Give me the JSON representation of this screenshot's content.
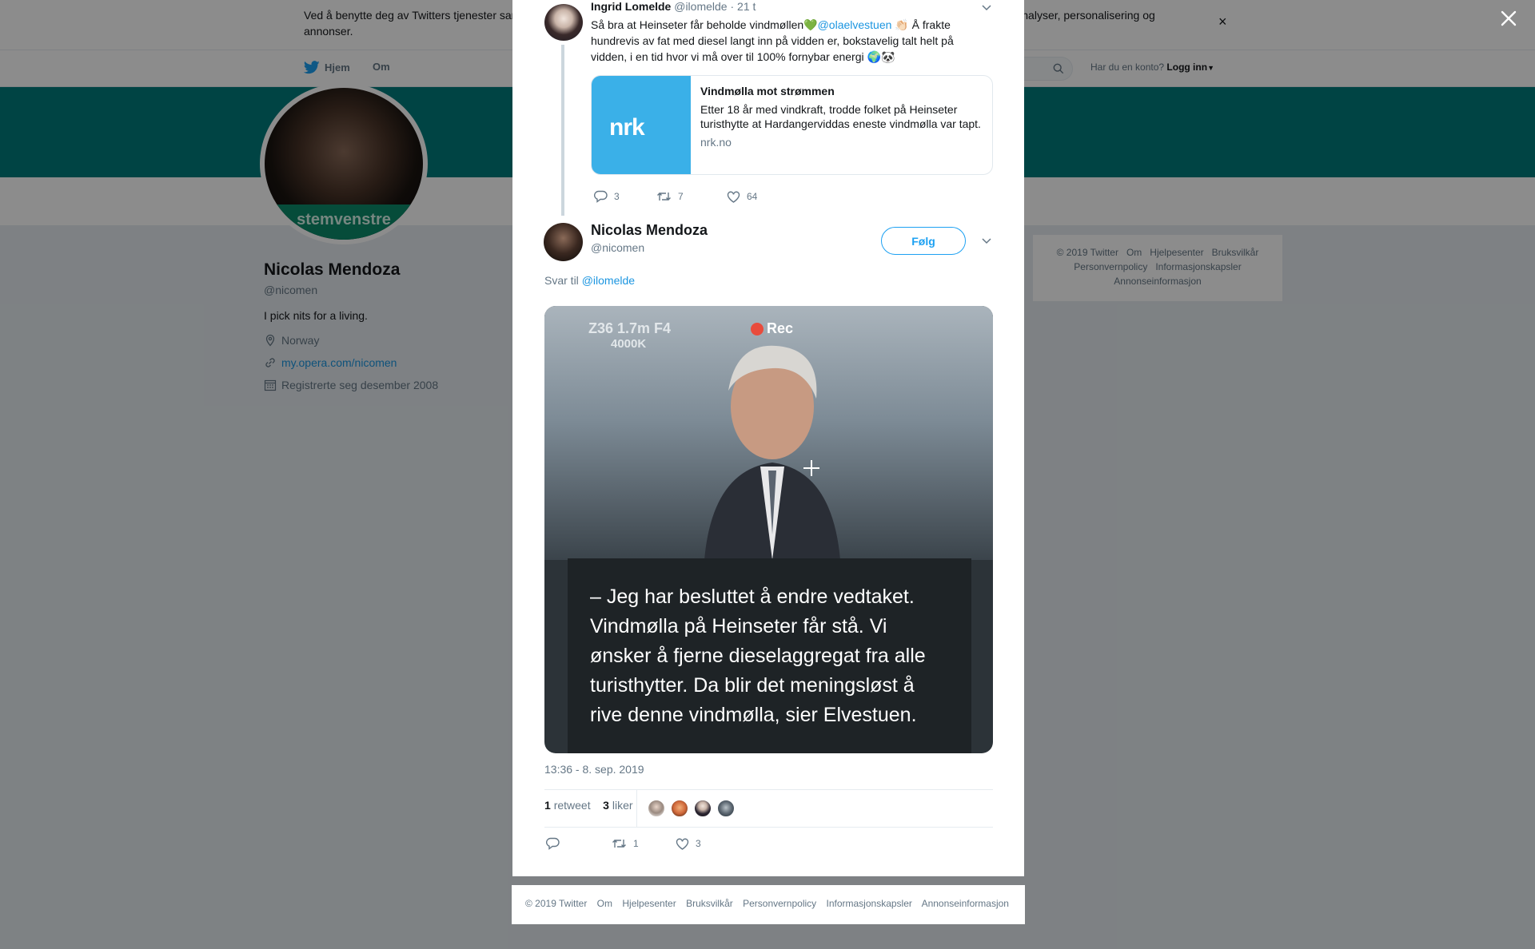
{
  "cookie_banner": {
    "text": "Ved å benytte deg av Twitters tjenester samtykker du i vår bruk av informasjonskapsler. Vi og partnerne våre bruker informasjonskapsler til bl.a. analyser, personalisering og annonser.",
    "close": "×"
  },
  "nav": {
    "home": "Hjem",
    "about": "Om",
    "login_prompt": "Har du en konto?",
    "login": "Logg inn"
  },
  "profile": {
    "avatar_text": "stemvenstre",
    "name": "Nicolas Mendoza",
    "handle": "@nicomen",
    "bio": "I pick nits for a living.",
    "location": "Norway",
    "url": "my.opera.com/nicomen",
    "joined": "Registrerte seg desember 2008"
  },
  "side_footer": {
    "links": [
      "© 2019 Twitter",
      "Om",
      "Hjelpesenter",
      "Bruksvilkår",
      "Personvernpolicy",
      "Informasjonskapsler",
      "Annonseinformasjon"
    ]
  },
  "parent_tweet": {
    "name": "Ingrid Lomelde",
    "handle": "@ilomelde",
    "time": "· 21 t",
    "text_before": "Så bra at Heinseter får beholde vindmøllen",
    "emoji_heart": "💚",
    "mention": "@olaelvestuen",
    "emoji_clap": "👏🏻",
    "text_after": " Å frakte hundrevis av fat med diesel langt inn på vidden er, bokstavelig talt helt på vidden, i en tid hvor vi må over til 100% fornybar energi ",
    "emoji_end": "🌍🐼",
    "card": {
      "logo": "nrk",
      "title": "Vindmølla mot strømmen",
      "description": "Etter 18 år med vindkraft, trodde folket på Heinseter turisthytte at Hardangerviddas eneste vindmølla var tapt.",
      "domain": "nrk.no"
    },
    "replies": "3",
    "retweets": "7",
    "likes": "64"
  },
  "main_tweet": {
    "name": "Nicolas Mendoza",
    "handle": "@nicomen",
    "follow_label": "Følg",
    "reply_prefix": "Svar til",
    "reply_mention": "@ilomelde",
    "media": {
      "hud": "Z36  1.7m  F4",
      "hud2": "4000K",
      "rec": "Rec",
      "quote": "– Jeg har besluttet å endre vedtaket. Vindmølla på Heinseter får stå. Vi ønsker å fjerne dieselaggregat fra alle turisthytter. Da blir det meningsløst å rive denne vindmølla, sier Elvestuen."
    },
    "timestamp": "13:36 - 8. sep. 2019",
    "retweet_count": "1",
    "retweet_label": "retweet",
    "like_count": "3",
    "like_label": "liker",
    "action_retweets": "1",
    "action_likes": "3"
  },
  "modal_footer": {
    "links": [
      "© 2019 Twitter",
      "Om",
      "Hjelpesenter",
      "Bruksvilkår",
      "Personvernpolicy",
      "Informasjonskapsler",
      "Annonseinformasjon"
    ]
  },
  "colors": {
    "brand_blue": "#1da1f2",
    "link_blue": "#1b95e0",
    "banner_teal": "#007c7d",
    "nrk_blue": "#3ab0e8"
  }
}
